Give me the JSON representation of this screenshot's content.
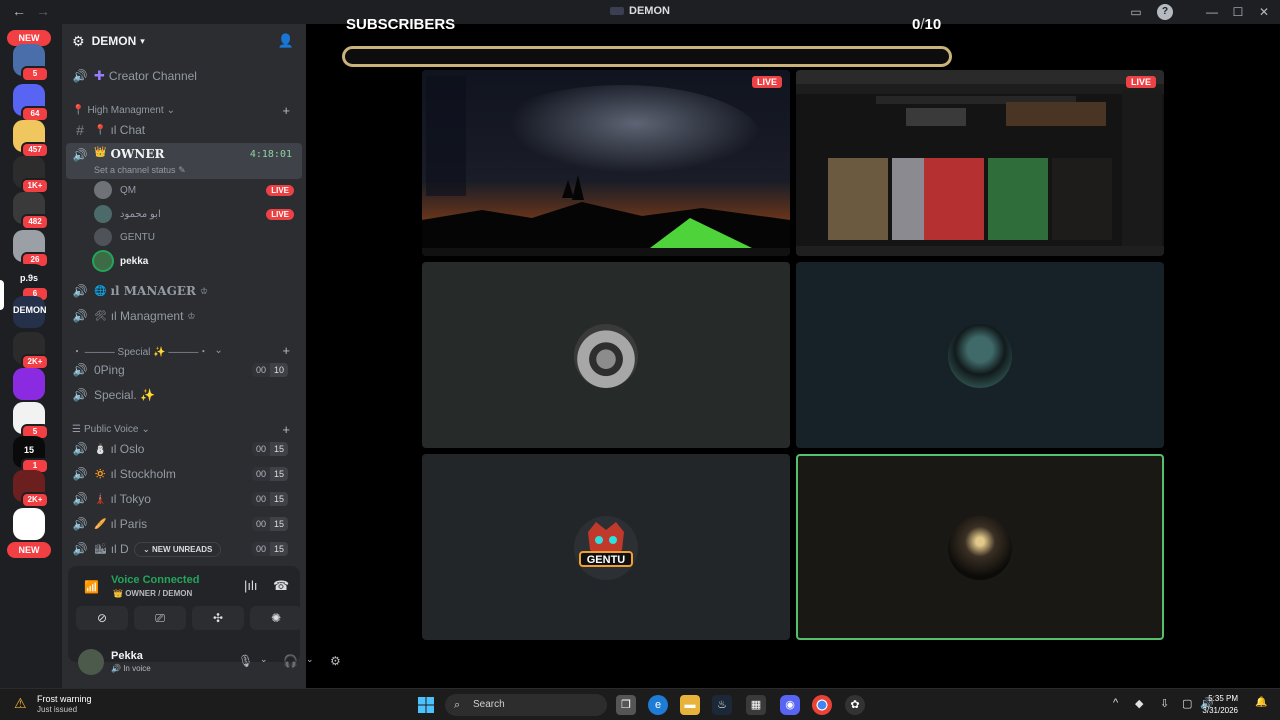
{
  "window": {
    "title": "DEMON"
  },
  "rail": {
    "new_top": "NEW",
    "new_bottom": "NEW",
    "servers": [
      {
        "badge": "5",
        "color": "#4a6ea9"
      },
      {
        "badge": "64",
        "color": "#5865f2"
      },
      {
        "badge": "457",
        "color": "#f0c75e"
      },
      {
        "badge": "1K+",
        "color": "#2c2c2c"
      },
      {
        "badge": "482",
        "color": "#3a3a3a"
      },
      {
        "badge": "26",
        "color": "#9aa0a6"
      },
      {
        "badge": "6",
        "label": "p.9s",
        "color": "#1e1f22"
      },
      {
        "badge": "",
        "label": "DEMON",
        "color": "#25304a"
      },
      {
        "badge": "2K+",
        "color": "#2b2b2b"
      },
      {
        "badge": "",
        "color": "#8a2be2"
      },
      {
        "badge": "5",
        "color": "#f2f2f2"
      },
      {
        "badge": "1",
        "label": "15",
        "color": "#0a0a0a"
      },
      {
        "badge": "2K+",
        "color": "#6b1f1f"
      },
      {
        "badge": "",
        "color": "#ffffff"
      }
    ]
  },
  "guild": {
    "name": "DEMON"
  },
  "channels": {
    "creator": "Creator Channel",
    "cat_high": "High Managment",
    "chat": "ıl Chat",
    "owner": "OWNER",
    "owner_timer": "4:18:01",
    "owner_status": "Set a channel status",
    "voice_users": [
      {
        "name": "QM",
        "live": "LIVE"
      },
      {
        "name": "ابو محمود",
        "live": "LIVE"
      },
      {
        "name": "GENTU",
        "live": ""
      },
      {
        "name": "pekka",
        "live": ""
      }
    ],
    "manager": "ıl MANAGER",
    "managment": "ıl Managment",
    "cat_special": "・ ——— Special ✨ ———・",
    "oping": "0Ping",
    "oping_limit": [
      "00",
      "10"
    ],
    "special": "Special. ✨",
    "cat_public": "Public Voice",
    "public": [
      {
        "name": "ıl Oslo",
        "emoji": "⛄",
        "limit": [
          "00",
          "15"
        ]
      },
      {
        "name": "ıl Stockholm",
        "emoji": "🔅",
        "limit": [
          "00",
          "15"
        ]
      },
      {
        "name": "ıl Tokyo",
        "emoji": "🗼",
        "limit": [
          "00",
          "15"
        ]
      },
      {
        "name": "ıl Paris",
        "emoji": "🥖",
        "limit": [
          "00",
          "15"
        ]
      },
      {
        "name": "ıl D",
        "emoji": "🏙",
        "limit": [
          "00",
          "15"
        ]
      }
    ],
    "new_unreads": "NEW UNREADS"
  },
  "voice": {
    "status": "Voice Connected",
    "channel": "OWNER / DEMON"
  },
  "user": {
    "name": "Pekka",
    "status": "In voice"
  },
  "stage": {
    "title": "SUBSCRIBERS",
    "count_current": "0",
    "count_sep": "/",
    "count_total": "10",
    "live_label": "LIVE"
  },
  "taskbar": {
    "warning_title": "Frost warning",
    "warning_sub": "Just issued",
    "search": "Search",
    "time": "5:35 PM",
    "date": "3/31/2026"
  },
  "colors": {
    "accent_green": "#23a55a",
    "live_red": "#ed4245",
    "progress_border": "#c9b37a"
  }
}
